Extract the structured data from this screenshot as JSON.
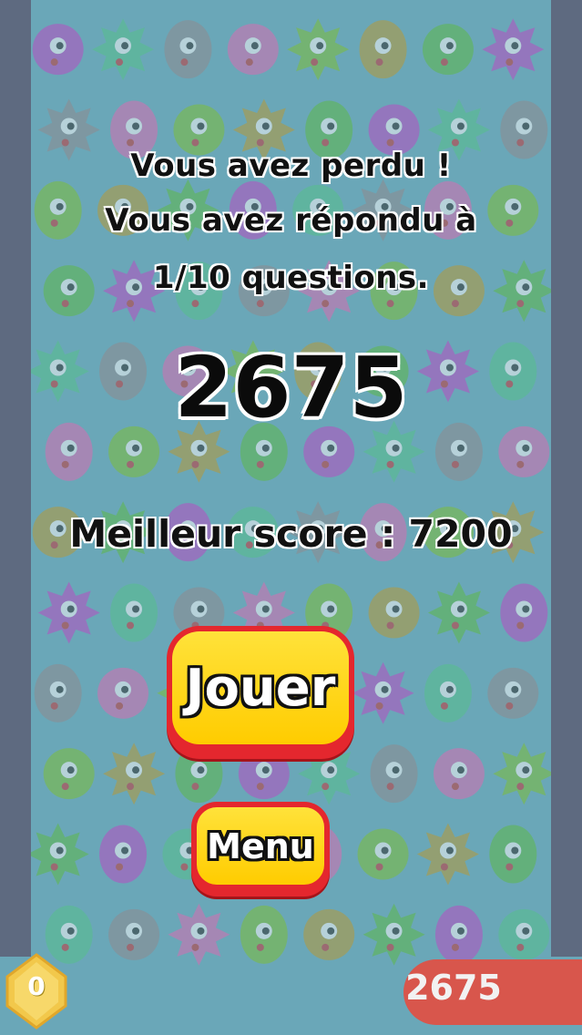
{
  "game_over": {
    "line1": "Vous avez perdu !",
    "line2": "Vous avez répondu à",
    "line3": "1/10 questions."
  },
  "score": "2675",
  "best_score": "Meilleur score : 7200",
  "buttons": {
    "play": "Jouer",
    "menu": "Menu"
  },
  "hud": {
    "coins": "0",
    "score": "2675"
  },
  "colors": {
    "board": "#6aa7b8",
    "sides": "#5e6a80",
    "button_fill": "#ffd21a",
    "button_border": "#e4272e",
    "score_pill": "#d8564c"
  }
}
